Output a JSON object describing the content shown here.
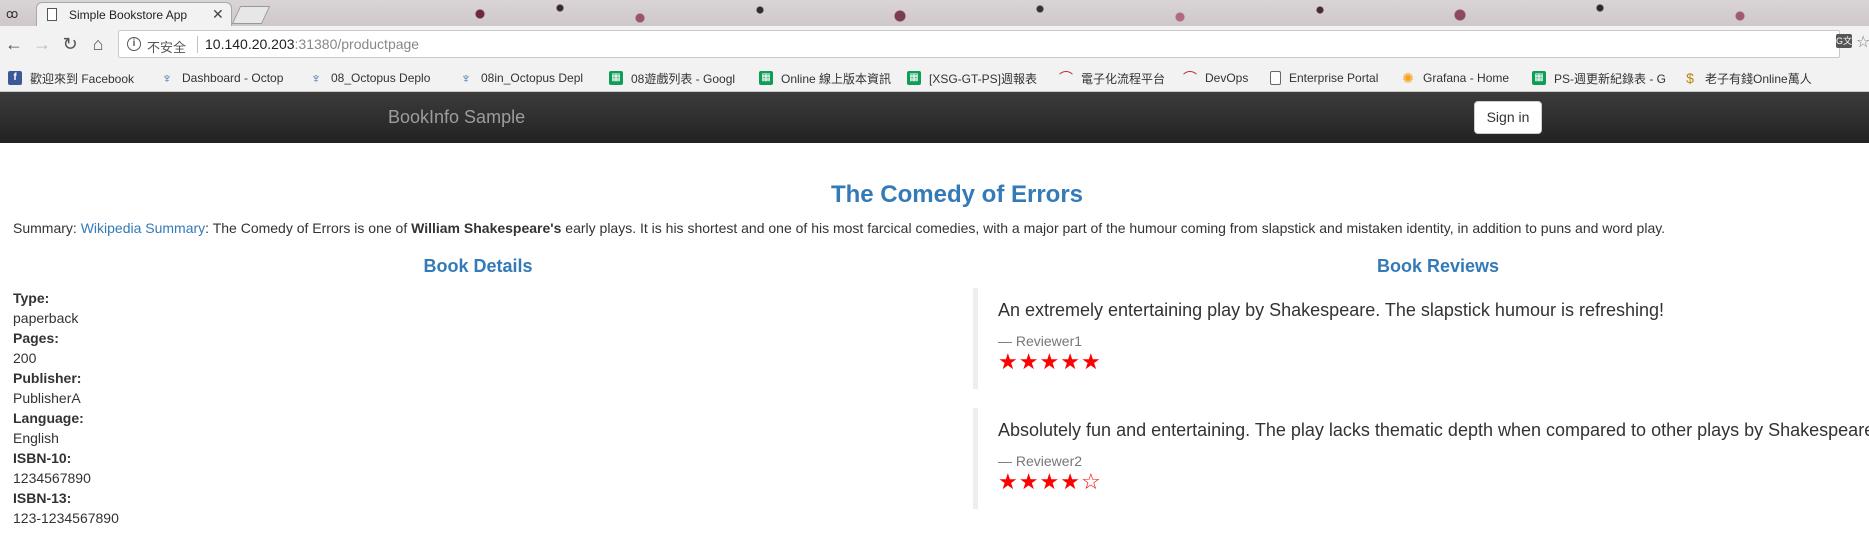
{
  "browser": {
    "tab_title": "Simple Bookstore App",
    "address_insecure_label": "不安全",
    "url_host": "10.140.20.203",
    "url_rest": ":31380/productpage",
    "bookmarks": [
      {
        "label": "歡迎來到 Facebook",
        "icon": "facebook-icon"
      },
      {
        "label": "Dashboard - Octop",
        "icon": "octopus-icon"
      },
      {
        "label": "08_Octopus Deplo",
        "icon": "octopus-icon"
      },
      {
        "label": "08in_Octopus Depl",
        "icon": "octopus-icon"
      },
      {
        "label": "08遊戲列表 - Googl",
        "icon": "google-sheets-icon"
      },
      {
        "label": "Online 線上版本資訊",
        "icon": "google-sheets-icon"
      },
      {
        "label": "[XSG-GT-PS]週報表",
        "icon": "google-sheets-icon"
      },
      {
        "label": "電子化流程平台",
        "icon": "arch-icon"
      },
      {
        "label": "DevOps",
        "icon": "arch-icon"
      },
      {
        "label": "Enterprise Portal",
        "icon": "document-icon"
      },
      {
        "label": "Grafana - Home",
        "icon": "grafana-icon"
      },
      {
        "label": "PS-週更新紀錄表 - G",
        "icon": "google-sheets-icon"
      },
      {
        "label": "老子有錢Online萬人",
        "icon": "money-bag-icon"
      }
    ]
  },
  "navbar": {
    "brand": "BookInfo Sample",
    "signin_label": "Sign in"
  },
  "product": {
    "title": "The Comedy of Errors",
    "summary_prefix": "Summary: ",
    "summary_link": "Wikipedia Summary",
    "summary_part1": ": The Comedy of Errors is one of ",
    "summary_bold": "William Shakespeare's",
    "summary_part2": " early plays. It is his shortest and one of his most farcical comedies, with a major part of the humour coming from slapstick and mistaken identity, in addition to puns and word play."
  },
  "details": {
    "heading": "Book Details",
    "items": [
      {
        "label": "Type:",
        "value": "paperback"
      },
      {
        "label": "Pages:",
        "value": "200"
      },
      {
        "label": "Publisher:",
        "value": "PublisherA"
      },
      {
        "label": "Language:",
        "value": "English"
      },
      {
        "label": "ISBN-10:",
        "value": "1234567890"
      },
      {
        "label": "ISBN-13:",
        "value": "123-1234567890"
      }
    ]
  },
  "reviews": {
    "heading": "Book Reviews",
    "items": [
      {
        "text": "An extremely entertaining play by Shakespeare. The slapstick humour is refreshing!",
        "reviewer": "— Reviewer1",
        "rating": 5,
        "max_rating": 5
      },
      {
        "text": "Absolutely fun and entertaining. The play lacks thematic depth when compared to other plays by Shakespeare.",
        "reviewer": "— Reviewer2",
        "rating": 4,
        "max_rating": 5
      }
    ],
    "star_color": "#ff0000"
  },
  "colors": {
    "link_blue": "#337ab7",
    "navbar_dark": "#222222",
    "text": "#333333"
  }
}
